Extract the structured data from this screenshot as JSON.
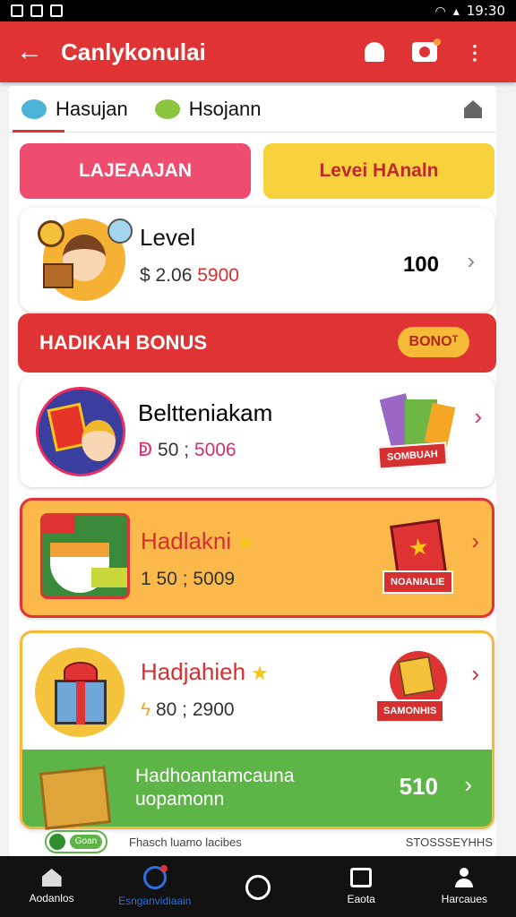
{
  "status_bar": {
    "time": "19:30"
  },
  "app_bar": {
    "title": "Canlykonulai",
    "back_icon": "arrow-left-icon"
  },
  "tabs": [
    {
      "label": "Hasujan",
      "icon": "bee-icon"
    },
    {
      "label": "Hsojann",
      "icon": "bee-icon"
    }
  ],
  "buttons": {
    "left": "LAJEAAJAN",
    "right": "Levei HAnaln"
  },
  "level_card": {
    "title": "Level",
    "sub_prefix": "$ 2.06",
    "sub_red": "5900",
    "value": "100"
  },
  "bonus_bar": {
    "label": "HADIKAH BONUS",
    "pill": "BONOᵀ"
  },
  "items": [
    {
      "title": "Beltteniakam",
      "sub_icon": "ↁ",
      "sub_num": "50",
      "sub_pink": "5006",
      "badge": "SOMBUAH"
    },
    {
      "title": "Hadlakni",
      "sub": "1 50 ; 5009",
      "badge": "NOANIALIE"
    },
    {
      "title": "Hadjahieh",
      "sub": "80 ; 2900",
      "badge": "SAMONHIS"
    }
  ],
  "green_bar": {
    "line1": "Hadhoantamcauna",
    "line2": "uopamonn",
    "value": "510"
  },
  "footer_row": {
    "chip": "Goan",
    "mid": "Fhasch luamo lacibes",
    "right": "STOSSSEYHHS"
  },
  "nav": [
    {
      "label": "Aodanlos",
      "icon": "home-icon"
    },
    {
      "label": "Esnganvidiaain",
      "icon": "play-icon"
    },
    {
      "label": "",
      "icon": "circle-icon"
    },
    {
      "label": "Eaota",
      "icon": "box-icon"
    },
    {
      "label": "Harcaues",
      "icon": "user-icon"
    }
  ],
  "colors": {
    "accent": "#e03434",
    "yellow": "#f8d23c",
    "pink": "#ee4d6f",
    "green": "#5eb547"
  }
}
